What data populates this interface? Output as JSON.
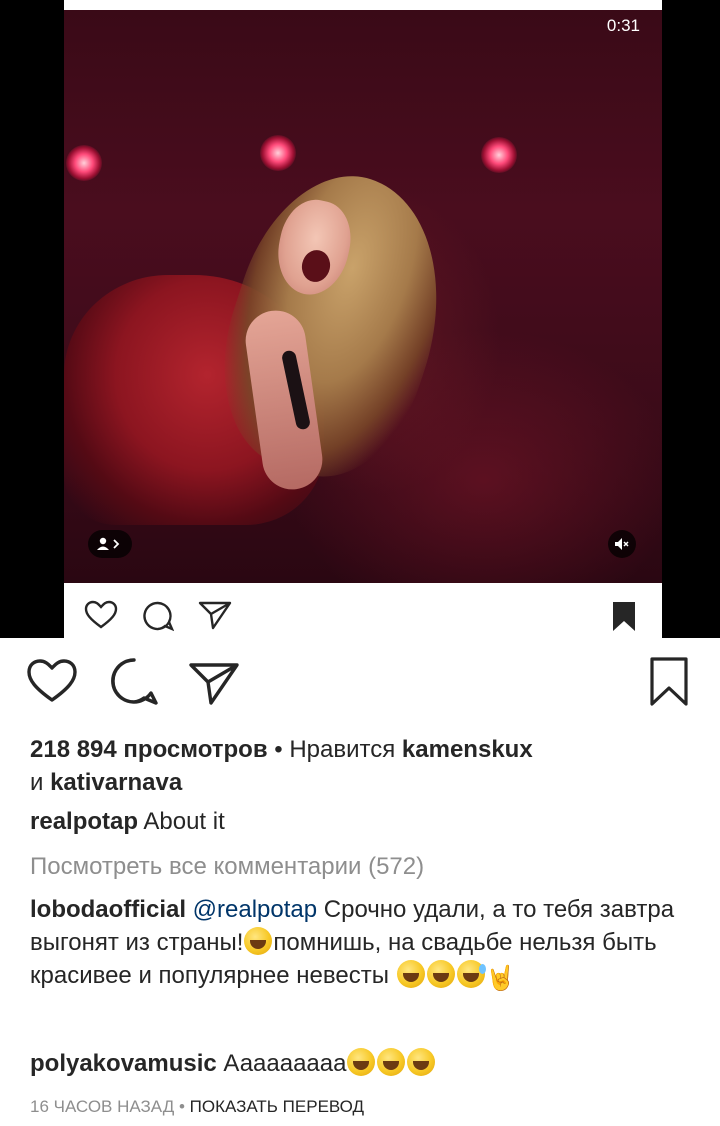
{
  "embed": {
    "timer": "0:31"
  },
  "post": {
    "views_count": "218 894 просмотров",
    "liked_by_prefix": " • Нравится ",
    "liked_user_1": "kamenskux",
    "liked_and": "и ",
    "liked_user_2": "kativarnava",
    "caption_user": "realpotap",
    "caption_text": " About it",
    "view_all_comments": "Посмотреть все комментарии (572)"
  },
  "comments": [
    {
      "user": "lobodaofficial",
      "mention": "@realpotap",
      "text_1": " Срочно удали, а то тебя завтра выгонят из страны!",
      "text_2": "помнишь,  на свадьбе нельзя быть красивее и популярнее невесты "
    },
    {
      "user": "polyakovamusic",
      "text": " Ааааааааа"
    }
  ],
  "meta": {
    "time_ago": "16 ЧАСОВ НАЗАД",
    "separator": " • ",
    "translate": "ПОКАЗАТЬ ПЕРЕВОД"
  },
  "icons": {
    "like": "heart-icon",
    "comment": "comment-icon",
    "share": "paper-plane-icon",
    "save": "bookmark-icon",
    "tag": "tagged-people-icon",
    "mute": "muted-speaker-icon",
    "emoji": "grinning-squinting-emoji"
  }
}
